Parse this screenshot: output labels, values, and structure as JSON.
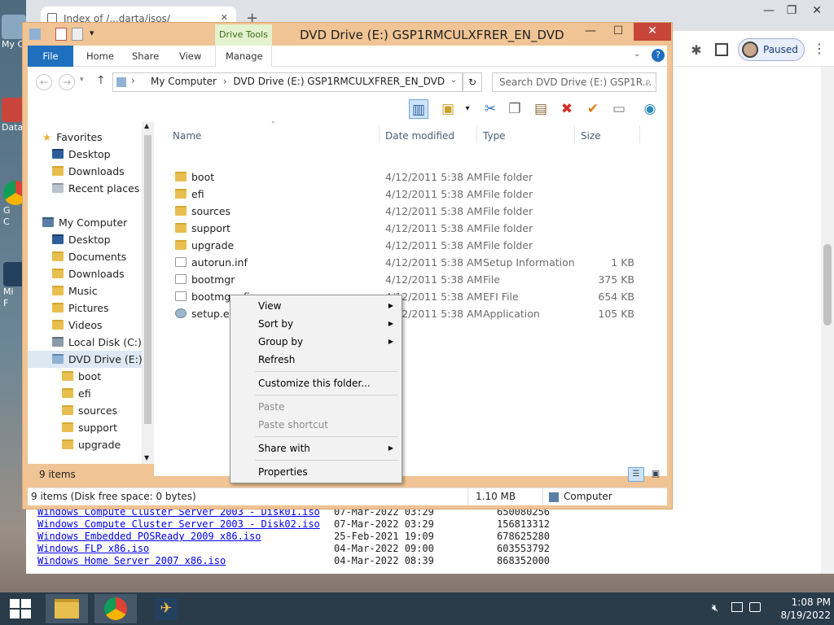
{
  "desktop": {
    "icons": [
      {
        "label": "My C",
        "icon": "computer-icon"
      },
      {
        "label": "Data",
        "icon": "tools-icon"
      },
      {
        "label": "G",
        "icon": "chrome-icon"
      },
      {
        "label": "C",
        "icon": "chrome-icon"
      },
      {
        "label": "Mi",
        "icon": "plane-icon"
      },
      {
        "label": "F",
        "icon": "plane-icon"
      }
    ]
  },
  "browser": {
    "tab_title": "Index of /...darta/isos/",
    "tab_close": "✕",
    "new_tab": "+",
    "paused_label": "Paused",
    "window_controls": [
      "—",
      "❐",
      "✕"
    ],
    "listing": [
      {
        "name": "Windows Compute Cluster Server 2003 - Disk01.iso",
        "date": "07-Mar-2022 03:29",
        "size": "650080256"
      },
      {
        "name": "Windows Compute Cluster Server 2003 - Disk02.iso",
        "date": "07-Mar-2022 03:29",
        "size": "156813312"
      },
      {
        "name": "Windows Embedded POSReady 2009 x86.iso",
        "date": "25-Feb-2021 19:09",
        "size": "678625280"
      },
      {
        "name": "Windows FLP x86.iso",
        "date": "04-Mar-2022 09:00",
        "size": "603553792"
      },
      {
        "name": "Windows Home Server 2007 x86.iso",
        "date": "04-Mar-2022 08:39",
        "size": "868352000"
      }
    ]
  },
  "explorer": {
    "title": "DVD Drive (E:) GSP1RMCULXFRER_EN_DVD",
    "context_tab": "Drive Tools",
    "ribbon_tabs": [
      "File",
      "Home",
      "Share",
      "View",
      "Manage"
    ],
    "breadcrumb": [
      "My Computer",
      "DVD Drive (E:) GSP1RMCULXFRER_EN_DVD"
    ],
    "search_placeholder": "Search DVD Drive (E:) GSP1R...",
    "columns": [
      "Name",
      "Date modified",
      "Type",
      "Size"
    ],
    "files": [
      {
        "name": "boot",
        "date": "4/12/2011 5:38 AM",
        "type": "File folder",
        "size": "",
        "icon": "folder-icon"
      },
      {
        "name": "efi",
        "date": "4/12/2011 5:38 AM",
        "type": "File folder",
        "size": "",
        "icon": "folder-icon"
      },
      {
        "name": "sources",
        "date": "4/12/2011 5:38 AM",
        "type": "File folder",
        "size": "",
        "icon": "folder-icon"
      },
      {
        "name": "support",
        "date": "4/12/2011 5:38 AM",
        "type": "File folder",
        "size": "",
        "icon": "folder-icon"
      },
      {
        "name": "upgrade",
        "date": "4/12/2011 5:38 AM",
        "type": "File folder",
        "size": "",
        "icon": "folder-icon"
      },
      {
        "name": "autorun.inf",
        "date": "4/12/2011 5:38 AM",
        "type": "Setup Information",
        "size": "1 KB",
        "icon": "settings-file-icon"
      },
      {
        "name": "bootmgr",
        "date": "4/12/2011 5:38 AM",
        "type": "File",
        "size": "375 KB",
        "icon": "file-icon"
      },
      {
        "name": "bootmgr.efi",
        "date": "4/12/2011 5:38 AM",
        "type": "EFI File",
        "size": "654 KB",
        "icon": "file-icon"
      },
      {
        "name": "setup.exe",
        "date": "4/12/2011 5:38 AM",
        "type": "Application",
        "size": "105 KB",
        "icon": "setup-icon"
      }
    ],
    "nav": {
      "favorites_label": "Favorites",
      "favorites": [
        "Desktop",
        "Downloads",
        "Recent places"
      ],
      "computer_label": "My Computer",
      "computer": [
        "Desktop",
        "Documents",
        "Downloads",
        "Music",
        "Pictures",
        "Videos",
        "Local Disk (C:)",
        "DVD Drive (E:) GS"
      ],
      "dvd_children": [
        "boot",
        "efi",
        "sources",
        "support",
        "upgrade"
      ]
    },
    "item_count": "9 items",
    "status": {
      "left": "9 items (Disk free space: 0 bytes)",
      "size": "1.10 MB",
      "location": "Computer"
    }
  },
  "context_menu": [
    {
      "label": "View",
      "submenu": true,
      "enabled": true
    },
    {
      "label": "Sort by",
      "submenu": true,
      "enabled": true
    },
    {
      "label": "Group by",
      "submenu": true,
      "enabled": true
    },
    {
      "label": "Refresh",
      "submenu": false,
      "enabled": true
    },
    {
      "label": "Customize this folder...",
      "submenu": false,
      "enabled": true
    },
    {
      "label": "Paste",
      "submenu": false,
      "enabled": false
    },
    {
      "label": "Paste shortcut",
      "submenu": false,
      "enabled": false
    },
    {
      "label": "Share with",
      "submenu": true,
      "enabled": true
    },
    {
      "label": "Properties",
      "submenu": false,
      "enabled": true
    }
  ],
  "taskbar": {
    "time": "1:08 PM",
    "date": "8/19/2022"
  },
  "colors": {
    "explorer_frame": "#f0c494",
    "file_tab": "#1f6fbf",
    "close_button": "#c7463a",
    "link": "#0000ee",
    "taskbar": "#2a3b4a"
  }
}
